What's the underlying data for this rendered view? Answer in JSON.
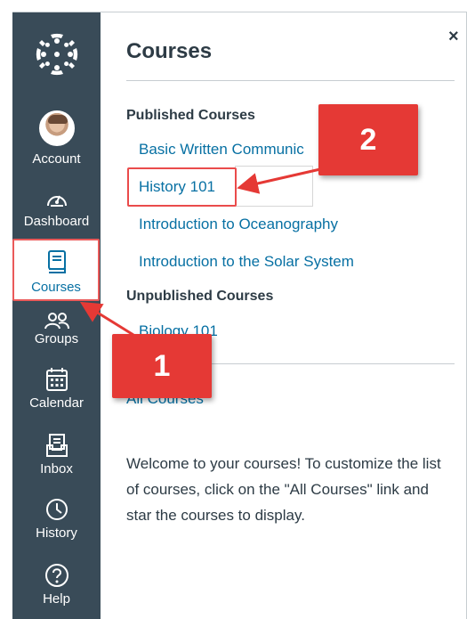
{
  "nav": {
    "items": [
      {
        "label": "Account",
        "icon": "avatar"
      },
      {
        "label": "Dashboard",
        "icon": "dashboard-icon"
      },
      {
        "label": "Courses",
        "icon": "courses-book-icon"
      },
      {
        "label": "Groups",
        "icon": "groups-icon"
      },
      {
        "label": "Calendar",
        "icon": "calendar-icon"
      },
      {
        "label": "Inbox",
        "icon": "inbox-icon"
      },
      {
        "label": "History",
        "icon": "history-clock-icon"
      },
      {
        "label": "Help",
        "icon": "help-icon"
      }
    ]
  },
  "tray": {
    "title": "Courses",
    "close_label": "×",
    "published_heading": "Published Courses",
    "published": [
      "Basic Written Communic",
      "History 101",
      "Introduction to Oceanography",
      "Introduction to the Solar System"
    ],
    "unpublished_heading": "Unpublished Courses",
    "unpublished": [
      "Biology 101"
    ],
    "all_courses_link": "All Courses",
    "welcome_text": "Welcome to your courses! To customize the list of courses, click on the \"All Courses\" link and star the courses to display."
  },
  "annotations": {
    "callout_1": "1",
    "callout_2": "2",
    "color": "#e53935"
  }
}
